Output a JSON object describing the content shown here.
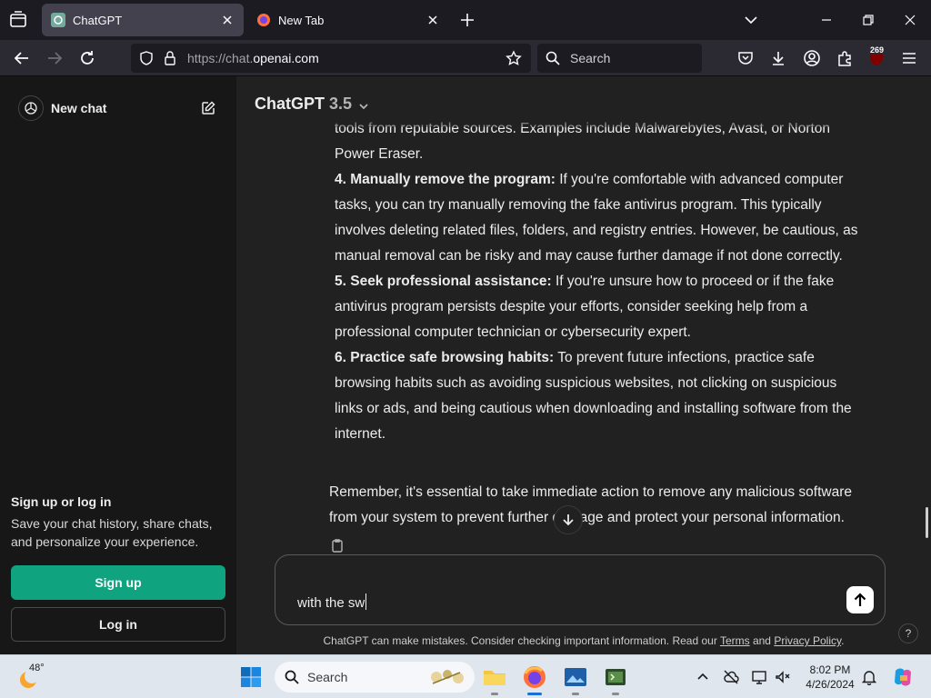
{
  "browser": {
    "tabs": [
      {
        "title": "ChatGPT",
        "active": true
      },
      {
        "title": "New Tab",
        "active": false
      }
    ],
    "url_prefix": "https://chat.",
    "url_domain": "openai.com",
    "search_placeholder": "Search",
    "extension_badge": "269"
  },
  "sidebar": {
    "new_chat": "New chat",
    "signup_heading": "Sign up or log in",
    "signup_text_1": "Save your chat history, share chats,",
    "signup_text_2": "and personalize your experience.",
    "signup_button": "Sign up",
    "login_button": "Log in"
  },
  "header": {
    "model": "ChatGPT",
    "version": "3.5"
  },
  "conversation": {
    "lines": [
      {
        "bold": "",
        "text": "tools from reputable sources. Examples include Malwarebytes, Avast, or Norton"
      },
      {
        "bold": "",
        "text": "Power Eraser."
      },
      {
        "bold": "4. Manually remove the program:",
        "text": " If you're comfortable with advanced computer"
      },
      {
        "bold": "",
        "text": "tasks, you can try manually removing the fake antivirus program. This typically"
      },
      {
        "bold": "",
        "text": "involves deleting related files, folders, and registry entries. However, be cautious, as"
      },
      {
        "bold": "",
        "text": "manual removal can be risky and may cause further damage if not done correctly."
      },
      {
        "bold": "5. Seek professional assistance:",
        "text": " If you're unsure how to proceed or if the fake"
      },
      {
        "bold": "",
        "text": "antivirus program persists despite your efforts, consider seeking help from a"
      },
      {
        "bold": "",
        "text": "professional computer technician or cybersecurity expert."
      },
      {
        "bold": "6. Practice safe browsing habits:",
        "text": " To prevent future infections, practice safe"
      },
      {
        "bold": "",
        "text": "browsing habits such as avoiding suspicious websites, not clicking on suspicious"
      },
      {
        "bold": "",
        "text": "links or ads, and being cautious when downloading and installing software from the"
      },
      {
        "bold": "",
        "text": "internet."
      }
    ],
    "closing_1": "Remember, it's essential to take immediate action to remove any malicious software",
    "closing_2": "from your system to prevent further damage and protect your personal information."
  },
  "composer": {
    "value": "with the sw"
  },
  "footer": {
    "disclaimer_pre": "ChatGPT can make mistakes. Consider checking important information. Read our ",
    "terms": "Terms",
    "and": " and ",
    "privacy": "Privacy Policy",
    "dot": ".",
    "help": "?"
  },
  "taskbar": {
    "temperature": "48°",
    "search_label": "Search",
    "time": "8:02 PM",
    "date": "4/26/2024"
  },
  "colors": {
    "accent_green": "#10a37f",
    "page_bg": "#212121",
    "sidebar_bg": "#171717"
  }
}
